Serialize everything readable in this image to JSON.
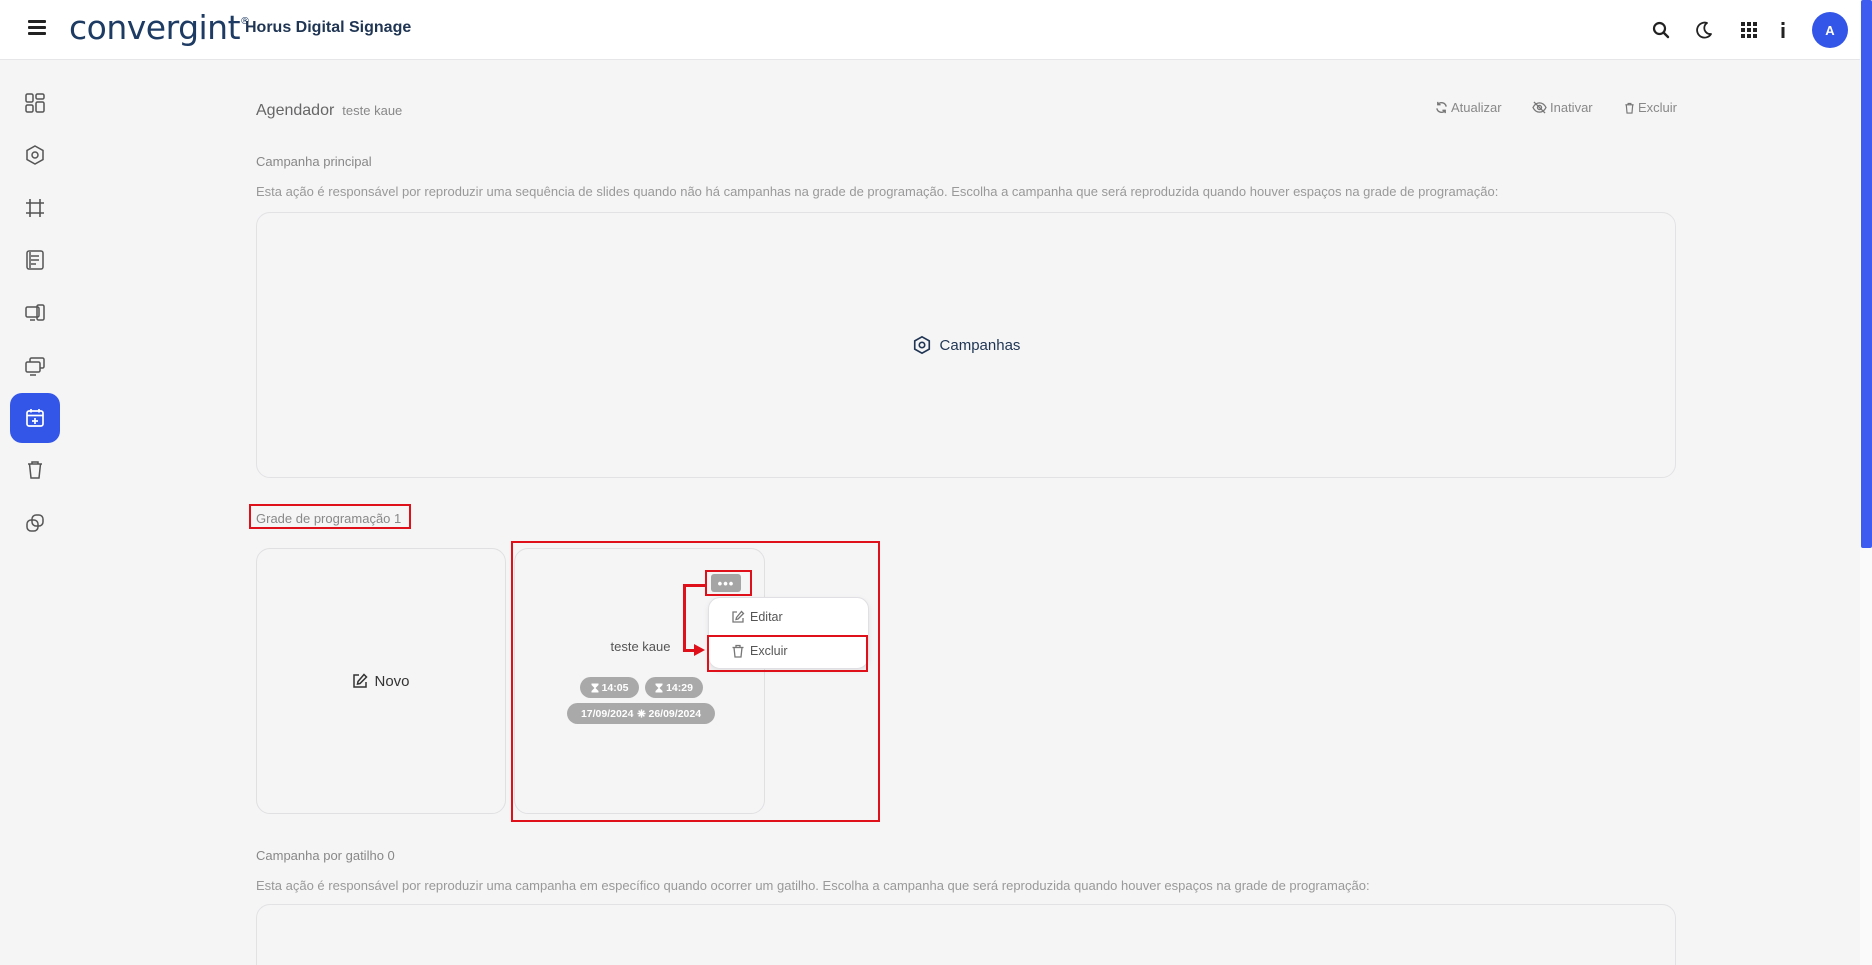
{
  "header": {
    "logo": "convergint",
    "logo_mark": "®",
    "app_title": "Horus Digital Signage",
    "avatar_initial": "A",
    "icons": [
      "search-icon",
      "moon-icon",
      "apps-grid-icon",
      "info-icon"
    ]
  },
  "sidebar": {
    "items": [
      {
        "icon": "dashboard-icon"
      },
      {
        "icon": "campaign-icon"
      },
      {
        "icon": "frame-icon"
      },
      {
        "icon": "newspaper-icon"
      },
      {
        "icon": "devices-icon"
      },
      {
        "icon": "screens-icon"
      },
      {
        "icon": "calendar-plus-icon",
        "active": true
      },
      {
        "icon": "trash-icon"
      },
      {
        "icon": "link-icon"
      }
    ]
  },
  "page": {
    "title": "Agendador",
    "subtitle": "teste kaue",
    "actions": {
      "refresh": "Atualizar",
      "deactivate": "Inativar",
      "delete": "Excluir"
    }
  },
  "main_campaign": {
    "label": "Campanha principal",
    "description": "Esta ação é responsável por reproduzir uma sequência de slides quando não há campanhas na grade de programação. Escolha a campanha que será reproduzida quando houver espaços na grade de programação:",
    "button": "Campanhas"
  },
  "schedule_grid": {
    "label": "Grade de programação 1",
    "new_button": "Novo",
    "item": {
      "name": "teste kaue",
      "start_time": "14:05",
      "end_time": "14:29",
      "start_date": "17/09/2024",
      "end_date": "26/09/2024",
      "menu_button": "•••",
      "menu": {
        "edit": "Editar",
        "delete": "Excluir"
      }
    }
  },
  "trigger_campaign": {
    "label": "Campanha por gatilho 0",
    "description": "Esta ação é responsável por reproduzir uma campanha em específico quando ocorrer um gatilho. Escolha a campanha que será reproduzida quando houver espaços na grade de programação:"
  },
  "colors": {
    "accent": "#3356e8",
    "annotation": "#e0101a",
    "brand_text": "#1e3b63"
  }
}
